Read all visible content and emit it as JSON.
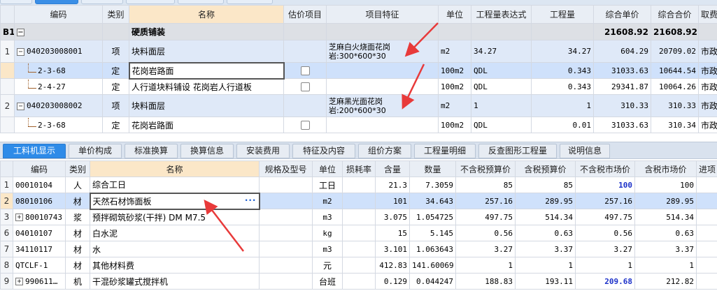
{
  "upper": {
    "headers": [
      "编码",
      "类别",
      "名称",
      "估价项目",
      "项目特征",
      "单位",
      "工程量表达式",
      "工程量",
      "综合单价",
      "综合合价",
      "取费"
    ],
    "group": {
      "no": "B1",
      "name": "硬质铺装",
      "unit_price": "21608.92",
      "total": "21608.92"
    },
    "rows": [
      {
        "no": "1",
        "code": "040203008001",
        "type": "项",
        "name": "块料面层",
        "feature": "芝麻白火烧面花岗岩:300*600*30",
        "unit": "m2",
        "expr": "34.27",
        "qty": "34.27",
        "price": "604.29",
        "total": "20709.02",
        "fee": "市政道"
      },
      {
        "no": "",
        "code": "2-3-68",
        "type": "定",
        "name": "花岗岩路面",
        "feature": "",
        "unit": "100m2",
        "expr": "QDL",
        "qty": "0.343",
        "price": "31033.63",
        "total": "10644.54",
        "fee": "市政道"
      },
      {
        "no": "",
        "code": "2-4-27",
        "type": "定",
        "name": "人行道块料铺设 花岗岩人行道板",
        "feature": "",
        "unit": "100m2",
        "expr": "QDL",
        "qty": "0.343",
        "price": "29341.87",
        "total": "10064.26",
        "fee": "市政道"
      },
      {
        "no": "2",
        "code": "040203008002",
        "type": "项",
        "name": "块料面层",
        "feature": "芝麻黑光面花岗岩:200*600*30",
        "unit": "m2",
        "expr": "1",
        "qty": "1",
        "price": "310.33",
        "total": "310.33",
        "fee": "市政道"
      },
      {
        "no": "",
        "code": "2-3-68",
        "type": "定",
        "name": "花岗岩路面",
        "feature": "",
        "unit": "100m2",
        "expr": "QDL",
        "qty": "0.01",
        "price": "31033.63",
        "total": "310.34",
        "fee": "市政道"
      }
    ]
  },
  "tabs": [
    "工料机显示",
    "单价构成",
    "标准换算",
    "换算信息",
    "安装费用",
    "特征及内容",
    "组价方案",
    "工程量明细",
    "反查图形工程量",
    "说明信息"
  ],
  "lower": {
    "headers": [
      "编码",
      "类别",
      "名称",
      "规格及型号",
      "单位",
      "损耗率",
      "含量",
      "数量",
      "不含税预算价",
      "含税预算价",
      "不含税市场价",
      "含税市场价",
      "进项"
    ],
    "rows": [
      {
        "no": "1",
        "code": "00010104",
        "type": "人",
        "name": "综合工日",
        "spec": "",
        "unit": "工日",
        "loss": "",
        "content": "21.3",
        "qty": "7.3059",
        "pre_notax": "85",
        "pre_tax": "85",
        "mkt_notax": "100",
        "mkt_tax": "100"
      },
      {
        "no": "2",
        "code": "08010106",
        "type": "材",
        "name": "天然石材饰面板",
        "spec": "",
        "unit": "m2",
        "loss": "",
        "content": "101",
        "qty": "34.643",
        "pre_notax": "257.16",
        "pre_tax": "289.95",
        "mkt_notax": "257.16",
        "mkt_tax": "289.95"
      },
      {
        "no": "3",
        "code": "80010743",
        "type": "浆",
        "name": "预拌砌筑砂浆(干拌) DM M7.5",
        "spec": "",
        "unit": "m3",
        "loss": "",
        "content": "3.075",
        "qty": "1.054725",
        "pre_notax": "497.75",
        "pre_tax": "514.34",
        "mkt_notax": "497.75",
        "mkt_tax": "514.34"
      },
      {
        "no": "6",
        "code": "04010107",
        "type": "材",
        "name": "白水泥",
        "spec": "",
        "unit": "kg",
        "loss": "",
        "content": "15",
        "qty": "5.145",
        "pre_notax": "0.56",
        "pre_tax": "0.63",
        "mkt_notax": "0.56",
        "mkt_tax": "0.63"
      },
      {
        "no": "7",
        "code": "34110117",
        "type": "材",
        "name": "水",
        "spec": "",
        "unit": "m3",
        "loss": "",
        "content": "3.101",
        "qty": "1.063643",
        "pre_notax": "3.27",
        "pre_tax": "3.37",
        "mkt_notax": "3.27",
        "mkt_tax": "3.37"
      },
      {
        "no": "8",
        "code": "QTCLF-1",
        "type": "材",
        "name": "其他材料费",
        "spec": "",
        "unit": "元",
        "loss": "",
        "content": "412.83",
        "qty": "141.60069",
        "pre_notax": "1",
        "pre_tax": "1",
        "mkt_notax": "1",
        "mkt_tax": "1"
      },
      {
        "no": "9",
        "code": "990611…",
        "type": "机",
        "name": "干混砂浆罐式搅拌机",
        "spec": "",
        "unit": "台班",
        "loss": "",
        "content": "0.129",
        "qty": "0.044247",
        "pre_notax": "188.83",
        "pre_tax": "193.11",
        "mkt_notax": "209.68",
        "mkt_tax": "212.82"
      }
    ],
    "ellipsis": "···"
  },
  "colors": {
    "accent": "#2e8be8",
    "arrow": "#e83a3a",
    "market_price_highlight": "#1c31c9"
  }
}
